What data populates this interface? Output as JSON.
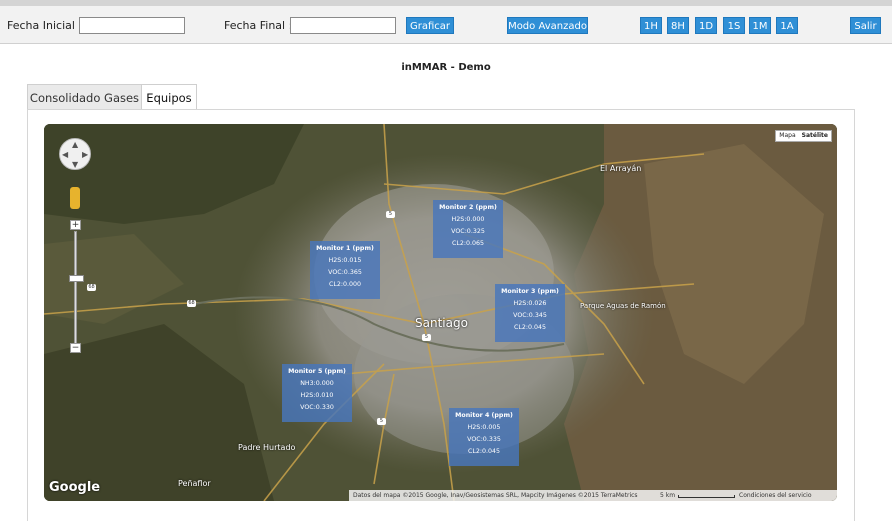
{
  "toolbar": {
    "fecha_inicial_label": "Fecha Inicial :",
    "fecha_inicial_value": "",
    "fecha_final_label": "Fecha Final :",
    "fecha_final_value": "",
    "graficar": "Graficar",
    "modo_avanzado": "Modo Avanzado",
    "ranges": [
      "1H",
      "8H",
      "1D",
      "1S",
      "1M",
      "1A"
    ],
    "salir": "Salir",
    "button_color": "#2f8fd6"
  },
  "page_title": "inMMAR - Demo",
  "tabs": [
    {
      "label": "Consolidado Gases",
      "active": false
    },
    {
      "label": "Equipos",
      "active": true
    }
  ],
  "map": {
    "type_options": [
      "Mapa",
      "Satélite"
    ],
    "selected_type": "Satélite",
    "monitors": [
      {
        "title": "Monitor 1 (ppm)",
        "lines": [
          "H2S:0.015",
          "VOC:0.365",
          "CL2:0.000"
        ]
      },
      {
        "title": "Monitor 2 (ppm)",
        "lines": [
          "H2S:0.000",
          "VOC:0.325",
          "CL2:0.065"
        ]
      },
      {
        "title": "Monitor 3 (ppm)",
        "lines": [
          "H2S:0.026",
          "VOC:0.345",
          "CL2:0.045"
        ]
      },
      {
        "title": "Monitor 4 (ppm)",
        "lines": [
          "H2S:0.005",
          "VOC:0.335",
          "CL2:0.045"
        ]
      },
      {
        "title": "Monitor 5 (ppm)",
        "lines": [
          "NH3:0.000",
          "H2S:0.010",
          "VOC:0.330"
        ]
      }
    ],
    "places": {
      "santiago": "Santiago",
      "arrayan": "El Arrayán",
      "parque": "Parque Aguas de Ramón",
      "padre": "Padre Hurtado",
      "penaflor": "Peñaflor"
    },
    "route_shields": [
      "5",
      "5",
      "5",
      "68",
      "68"
    ],
    "google": "Google",
    "attribution": "Datos del mapa ©2015 Google, Inav/Geosistemas SRL, Mapcity Imágenes ©2015 TerraMetrics",
    "scale": "5 km",
    "terms": "Condiciones del servicio",
    "zoom_in": "+",
    "zoom_out": "−"
  }
}
